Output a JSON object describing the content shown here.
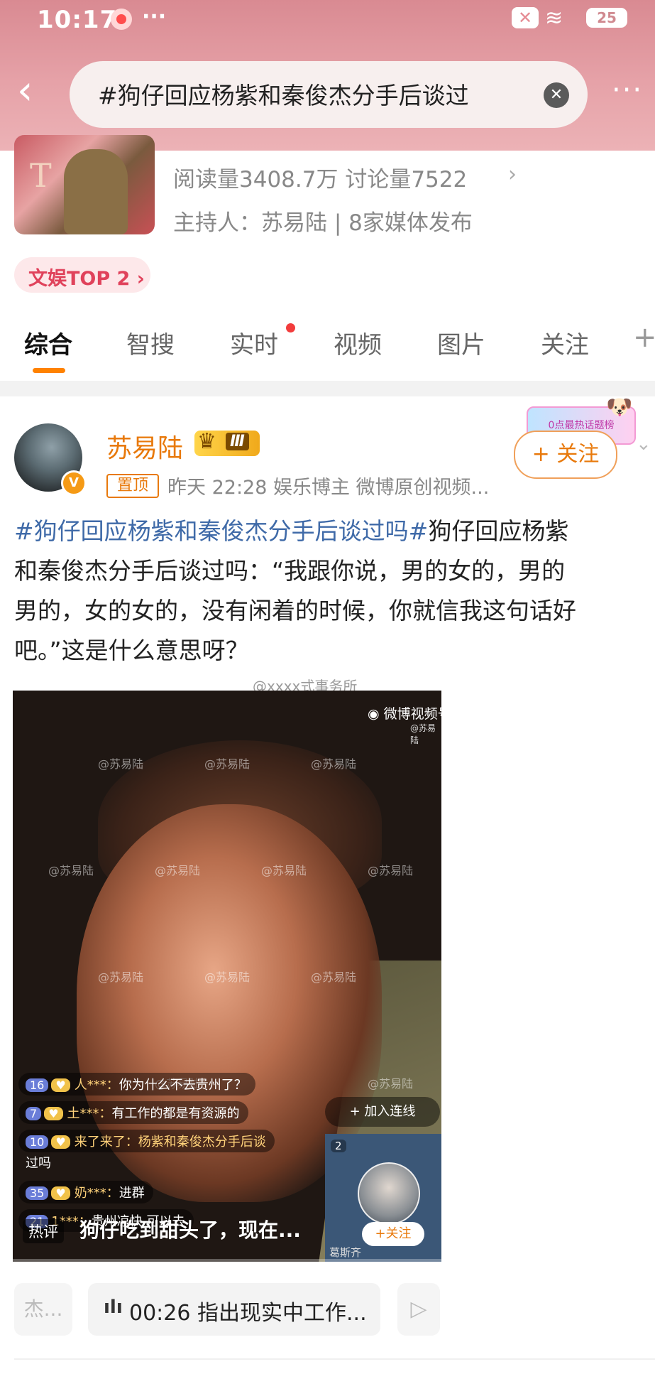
{
  "status_bar": {
    "time": "10:17",
    "menu_dots": "···",
    "battery": "25",
    "sim_icon": "sim-off-icon",
    "wifi_icon": "wifi-icon"
  },
  "search": {
    "query": "#狗仔回应杨紫和秦俊杰分手后谈过",
    "back_icon": "back-arrow-icon",
    "more_dots": "···"
  },
  "topic": {
    "thumb_letter": "T",
    "stats": "阅读量3408.7万   讨论量7522",
    "arrow": "›",
    "host": "主持人：苏易陆 | 8家媒体发布",
    "rank": "文娱TOP 2 ›"
  },
  "tabs": [
    {
      "label": "综合",
      "active": true
    },
    {
      "label": "智搜"
    },
    {
      "label": "实时",
      "dot": true
    },
    {
      "label": "视频"
    },
    {
      "label": "图片"
    },
    {
      "label": "关注"
    },
    {
      "label": "+"
    }
  ],
  "post": {
    "author": "苏易陆",
    "vip_level": "Ⅲ",
    "verified_mark": "V",
    "pin_label": "置顶",
    "meta": "昨天 22:28   娱乐博主  微博原创视频...",
    "follow_label": "+ 关注",
    "ad_banner": "0点最热话题榜",
    "hashtag": "#狗仔回应杨紫和秦俊杰分手后谈过吗#",
    "body_line1_rest": "狗仔回应杨紫",
    "body_line2": "和秦俊杰分手后谈过吗：“我跟你说，男的女的，男的",
    "body_line3": "男的，女的女的，没有闲着的时候，你就信我这句话好",
    "body_line4": "吧。”这是什么意思呀？",
    "image_watermark": "@xxxx式事务所"
  },
  "video": {
    "brand": "微博视频号",
    "brand_sub": "@苏易陆",
    "watermark": "@苏易陆",
    "comments": [
      {
        "level": "16",
        "user": "人***：",
        "text": "你为什么不去贵州了？"
      },
      {
        "level": "7",
        "user": "土***：",
        "text": "有工作的都是有资源的"
      },
      {
        "level": "10",
        "user": "来了来了：",
        "text": "杨紫和秦俊杰分手后谈"
      },
      {
        "level": "",
        "user": "",
        "text": "过吗"
      },
      {
        "level": "35",
        "user": "奶***：",
        "text": "进群"
      },
      {
        "level": "21",
        "user": "1***：",
        "text": "贵州凉快 可以去"
      }
    ],
    "join_label": "+ 加入连线",
    "pip_badge": "2",
    "pip_follow": "+关注",
    "pip_name": "葛斯齐",
    "hot_label": "热评",
    "hot_comment": "狗仔吃到甜头了，现在..."
  },
  "audio": {
    "left_chip": "杰...",
    "time": "00:26",
    "title": "指出现实中工作...",
    "right_icon": "play-icon"
  }
}
